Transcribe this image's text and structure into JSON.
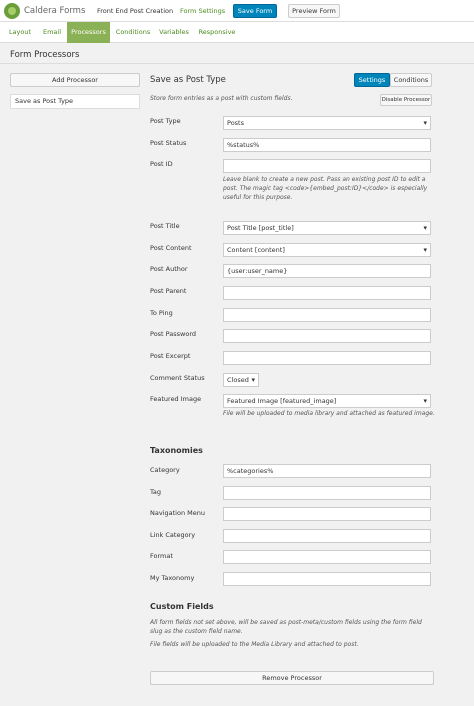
{
  "header": {
    "brand": "Caldera Forms",
    "form_name": "Front End Post Creation",
    "form_settings": "Form Settings",
    "save_form": "Save Form",
    "preview_form": "Preview Form"
  },
  "subnav": [
    "Layout",
    "Email",
    "Processors",
    "Conditions",
    "Variables",
    "Responsive"
  ],
  "panel_title": "Form Processors",
  "sidebar": {
    "add_processor": "Add Processor",
    "items": [
      "Save as Post Type"
    ]
  },
  "processor": {
    "title": "Save as Post Type",
    "settings_tab": "Settings",
    "conditions_tab": "Conditions",
    "description": "Store form entries as a post with custom fields.",
    "disable_button": "Disable Processor",
    "post_id_help": "Leave blank to create a new post. Pass an existing post ID to edit a post. The magic tag <code>{embed_post:ID}</code> is especially useful for this purpose.",
    "featured_help": "File will be uploaded to media library and attached as featured image.",
    "fields": [
      {
        "label": "Post Type",
        "value": "Posts"
      },
      {
        "label": "Post Status",
        "value": "%status%"
      },
      {
        "label": "Post ID",
        "value": ""
      },
      {
        "label": "Post Title",
        "value": "Post Title [post_title]"
      },
      {
        "label": "Post Content",
        "value": "Content [content]"
      },
      {
        "label": "Post Author",
        "value": "{user:user_name}"
      },
      {
        "label": "Post Parent",
        "value": ""
      },
      {
        "label": "To Ping",
        "value": ""
      },
      {
        "label": "Post Password",
        "value": ""
      },
      {
        "label": "Post Excerpt",
        "value": ""
      },
      {
        "label": "Comment Status",
        "value": "Closed"
      },
      {
        "label": "Featured Image",
        "value": "Featured Image [featured_image]"
      }
    ],
    "taxonomies_title": "Taxonomies",
    "taxonomies": [
      {
        "label": "Category",
        "value": "%categories%"
      },
      {
        "label": "Tag",
        "value": ""
      },
      {
        "label": "Navigation Menu",
        "value": ""
      },
      {
        "label": "Link Category",
        "value": ""
      },
      {
        "label": "Format",
        "value": ""
      },
      {
        "label": "My Taxonomy",
        "value": ""
      }
    ],
    "custom_fields_title": "Custom Fields",
    "custom_fields_note_1": "All form fields not set above, will be saved as post-meta/custom fields using the form field slug as the custom field name.",
    "custom_fields_note_2": "File fields will be uploaded to the Media Library and attached to post.",
    "remove_button": "Remove Processor"
  }
}
